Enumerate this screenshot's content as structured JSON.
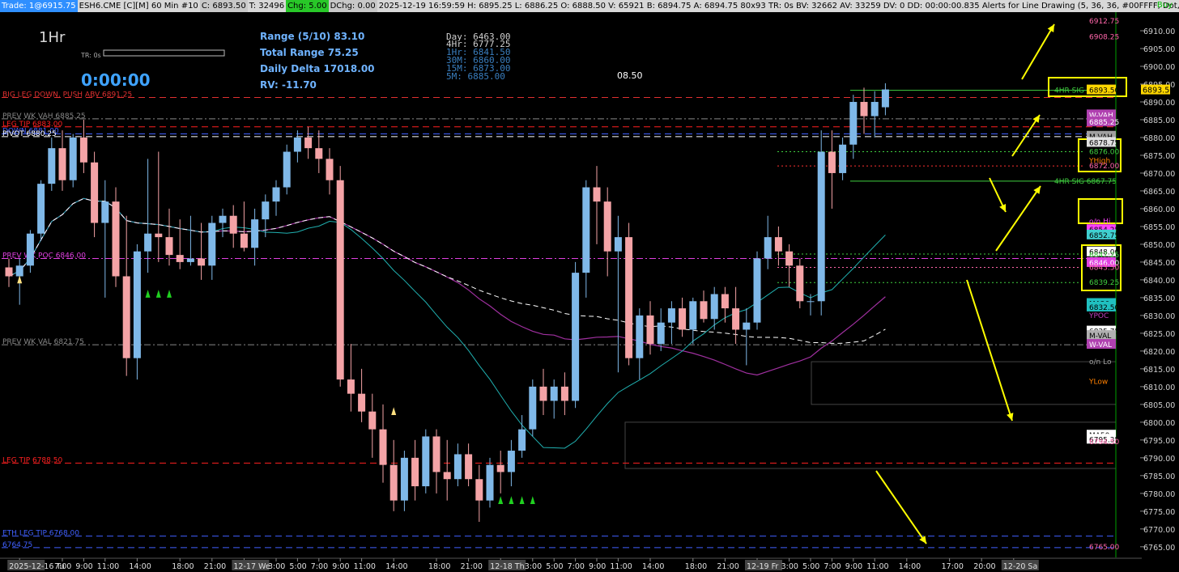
{
  "topbar": {
    "trade": "Trade: 1@6915.75",
    "symbol": "ESH6.CME [C][M]  60 Min  #10",
    "c": "C: 6893.50",
    "t": "T: 32496",
    "chg": "Chg: 5.00",
    "dchg": "DChg: 0.00",
    "info": "2025-12-19 16:59:59 H: 6895.25 L: 6886.25 O: 6888.50 V: 65921 B: 6894.75 A: 6894.75 80x93 TR: 0s BV: 32662 AV: 33259 DV: 0 DD: 00:00:00.835 Alerts for Line Drawing   (5, 36, 36, #00FFFF, Dot, 1, Yes, Right, Yes, 9, -2, No, Yes, 5",
    "buy": "Buy",
    "colors": {
      "trade_bg": "#2f8fff",
      "chg_bg": "#28c828",
      "gray_bg": "#c8c8c8"
    }
  },
  "overlay": {
    "timeframe": "1Hr",
    "tr_label": "TR: 0s",
    "timer": "0:00:00",
    "range": "Range (5/10) 83.10",
    "total_range": "Total Range 75.25",
    "daily_delta": "Daily Delta 17018.00",
    "rv": "RV: -11.70",
    "tf_values": [
      "Day:  6463.00",
      "4Hr:  6777.25",
      "1Hr:  6841.50",
      "30M:  6860.00",
      "15M:  6873.00",
      "5M:   6885.00"
    ],
    "mid_value": "08.50"
  },
  "chart_data": {
    "type": "candlestick",
    "symbol": "ESH6.CME",
    "interval": "60 Min",
    "ylim": [
      6762,
      6915
    ],
    "y_ticks": [
      6765,
      6770,
      6775,
      6780,
      6785,
      6790,
      6795,
      6800,
      6805,
      6810,
      6815,
      6820,
      6825,
      6830,
      6835,
      6840,
      6845,
      6850,
      6855,
      6860,
      6865,
      6870,
      6875,
      6880,
      6885,
      6890,
      6895,
      6900,
      6905,
      6910
    ],
    "x_labels": [
      {
        "bar": 1,
        "label": "2025-12-16 Tu",
        "boxed": true
      },
      {
        "bar": 5,
        "label": "7:00"
      },
      {
        "bar": 7,
        "label": "9:00"
      },
      {
        "bar": 9,
        "label": "11:00"
      },
      {
        "bar": 12,
        "label": "14:00"
      },
      {
        "bar": 16,
        "label": "18:00"
      },
      {
        "bar": 19,
        "label": "21:00"
      },
      {
        "bar": 22,
        "label": "12-17 We",
        "boxed": true
      },
      {
        "bar": 25,
        "label": "3:00"
      },
      {
        "bar": 27,
        "label": "5:00"
      },
      {
        "bar": 29,
        "label": "7:00"
      },
      {
        "bar": 31,
        "label": "9:00"
      },
      {
        "bar": 33,
        "label": "11:00"
      },
      {
        "bar": 36,
        "label": "14:00"
      },
      {
        "bar": 40,
        "label": "18:00"
      },
      {
        "bar": 43,
        "label": "21:00"
      },
      {
        "bar": 46,
        "label": "12-18 Th",
        "boxed": true
      },
      {
        "bar": 49,
        "label": "3:00"
      },
      {
        "bar": 51,
        "label": "5:00"
      },
      {
        "bar": 53,
        "label": "7:00"
      },
      {
        "bar": 55,
        "label": "9:00"
      },
      {
        "bar": 57,
        "label": "11:00"
      },
      {
        "bar": 60,
        "label": "14:00"
      },
      {
        "bar": 64,
        "label": "18:00"
      },
      {
        "bar": 67,
        "label": "21:00"
      },
      {
        "bar": 70,
        "label": "12-19 Fr",
        "boxed": true
      },
      {
        "bar": 73,
        "label": "3:00"
      },
      {
        "bar": 75,
        "label": "5:00"
      },
      {
        "bar": 77,
        "label": "7:00"
      },
      {
        "bar": 79,
        "label": "9:00"
      },
      {
        "bar": 81,
        "label": "11:00"
      },
      {
        "bar": 84,
        "label": "14:00"
      },
      {
        "bar": 88,
        "label": "17:00"
      },
      {
        "bar": 91,
        "label": "20:00"
      },
      {
        "bar": 94,
        "label": "12-20 Sa",
        "boxed": true
      }
    ],
    "candles": [
      [
        6843.5,
        6846,
        6838,
        6841
      ],
      [
        6841,
        6846,
        6833,
        6844
      ],
      [
        6844,
        6854,
        6842,
        6853
      ],
      [
        6853,
        6868,
        6851,
        6867
      ],
      [
        6867,
        6880,
        6865,
        6877
      ],
      [
        6877,
        6882,
        6865,
        6868
      ],
      [
        6868,
        6881,
        6866,
        6880
      ],
      [
        6880,
        6885,
        6870,
        6873
      ],
      [
        6873,
        6876,
        6852,
        6856
      ],
      [
        6856,
        6868,
        6835,
        6862
      ],
      [
        6862,
        6866,
        6838,
        6841
      ],
      [
        6841,
        6858,
        6813,
        6818
      ],
      [
        6818,
        6850,
        6812,
        6848
      ],
      [
        6848,
        6874,
        6842,
        6853
      ],
      [
        6853,
        6876,
        6845,
        6852
      ],
      [
        6852,
        6860,
        6844,
        6847
      ],
      [
        6847,
        6857,
        6843,
        6845
      ],
      [
        6845,
        6858,
        6844,
        6846
      ],
      [
        6846,
        6856,
        6840,
        6844
      ],
      [
        6844,
        6858,
        6840,
        6856
      ],
      [
        6856,
        6860,
        6852,
        6858
      ],
      [
        6858,
        6861,
        6849,
        6853
      ],
      [
        6853,
        6862,
        6848,
        6849
      ],
      [
        6849,
        6860,
        6844,
        6857
      ],
      [
        6857,
        6864,
        6852,
        6862
      ],
      [
        6862,
        6868,
        6858,
        6866
      ],
      [
        6866,
        6878,
        6864,
        6876
      ],
      [
        6876,
        6882,
        6873,
        6880
      ],
      [
        6880,
        6883,
        6874,
        6877
      ],
      [
        6877,
        6882,
        6870,
        6874
      ],
      [
        6874,
        6877,
        6864,
        6868
      ],
      [
        6868,
        6872,
        6810,
        6812
      ],
      [
        6812,
        6822,
        6803,
        6808
      ],
      [
        6808,
        6815,
        6800,
        6803
      ],
      [
        6803,
        6808,
        6790,
        6798
      ],
      [
        6798,
        6805,
        6783,
        6788
      ],
      [
        6788,
        6795,
        6775,
        6778
      ],
      [
        6778,
        6792,
        6775,
        6790
      ],
      [
        6790,
        6795,
        6778,
        6782
      ],
      [
        6782,
        6798,
        6780,
        6796
      ],
      [
        6796,
        6798,
        6780,
        6786
      ],
      [
        6786,
        6795,
        6778,
        6784
      ],
      [
        6784,
        6794,
        6782,
        6791
      ],
      [
        6791,
        6794,
        6782,
        6784
      ],
      [
        6784,
        6788,
        6772,
        6778
      ],
      [
        6778,
        6790,
        6776,
        6788
      ],
      [
        6788,
        6792,
        6780,
        6786
      ],
      [
        6786,
        6795,
        6782,
        6792
      ],
      [
        6792,
        6802,
        6790,
        6798
      ],
      [
        6798,
        6812,
        6796,
        6810
      ],
      [
        6810,
        6815,
        6802,
        6806
      ],
      [
        6806,
        6812,
        6801,
        6810
      ],
      [
        6810,
        6814,
        6802,
        6806
      ],
      [
        6806,
        6845,
        6804,
        6842
      ],
      [
        6842,
        6868,
        6835,
        6866
      ],
      [
        6866,
        6872,
        6850,
        6862
      ],
      [
        6862,
        6866,
        6841,
        6848
      ],
      [
        6848,
        6858,
        6814,
        6852
      ],
      [
        6852,
        6856,
        6816,
        6818
      ],
      [
        6818,
        6832,
        6812,
        6830
      ],
      [
        6830,
        6834,
        6819,
        6822
      ],
      [
        6822,
        6832,
        6820,
        6828
      ],
      [
        6828,
        6834,
        6822,
        6832
      ],
      [
        6832,
        6835,
        6824,
        6826
      ],
      [
        6826,
        6835,
        6822,
        6834
      ],
      [
        6834,
        6837,
        6828,
        6829
      ],
      [
        6829,
        6838,
        6826,
        6836
      ],
      [
        6836,
        6838,
        6828,
        6832
      ],
      [
        6832,
        6838,
        6822,
        6826
      ],
      [
        6826,
        6832,
        6816,
        6828
      ],
      [
        6828,
        6848,
        6826,
        6846
      ],
      [
        6846,
        6858,
        6843,
        6852
      ],
      [
        6852,
        6855,
        6844,
        6848
      ],
      [
        6848,
        6850,
        6838,
        6844
      ],
      [
        6844,
        6846,
        6832,
        6834
      ],
      [
        6834,
        6836,
        6830,
        6834
      ],
      [
        6834,
        6882,
        6830,
        6876
      ],
      [
        6876,
        6882,
        6860,
        6870
      ],
      [
        6870,
        6880,
        6868,
        6878
      ],
      [
        6878,
        6892,
        6874,
        6890
      ],
      [
        6890,
        6894,
        6881,
        6886
      ],
      [
        6886,
        6893,
        6880,
        6890
      ],
      [
        6888.5,
        6895.25,
        6886.25,
        6893.5
      ]
    ],
    "price_lines": [
      {
        "label": "BIG LEG DOWN, PUSH ABV  6891.25",
        "price": 6891.25,
        "color": "#e03030",
        "style": "dash"
      },
      {
        "label": "PREV WK VAH  6885.25",
        "price": 6885.25,
        "color": "#888888",
        "style": "dashdot"
      },
      {
        "label": "LEG TIP  6883.00",
        "price": 6883.0,
        "color": "#ff2020",
        "style": "dash"
      },
      {
        "label": "DOWN  6881.00",
        "price": 6881.0,
        "color": "#4060ff",
        "style": "dash"
      },
      {
        "label": "PIVOT  6880.25",
        "price": 6880.25,
        "color": "#ffffff",
        "style": "dash"
      },
      {
        "label": "PREV WK POC  6846.00",
        "price": 6846.0,
        "color": "#e040e0",
        "style": "dashdot"
      },
      {
        "label": "PREV WK VAL  6821.75",
        "price": 6821.75,
        "color": "#888888",
        "style": "dashdot"
      },
      {
        "label": "LEG TIP  6788.50",
        "price": 6788.5,
        "color": "#ff2020",
        "style": "dash"
      },
      {
        "label": "ETH LEG TIP  6768.00",
        "price": 6768.0,
        "color": "#4060ff",
        "style": "dash"
      },
      {
        "label": "6764.75",
        "price": 6764.75,
        "color": "#4060ff",
        "style": "dash"
      }
    ],
    "right_lines": [
      {
        "label": "4HR SIG  6893.25",
        "price": 6893.25,
        "color": "#40d040"
      },
      {
        "label": "4HR SIG  6867.75",
        "price": 6867.75,
        "color": "#40d040"
      }
    ],
    "axis_labels": [
      {
        "text": "6912.75",
        "price": 6912.75,
        "color": "#ff66aa",
        "style": "text"
      },
      {
        "text": "6908.25",
        "price": 6908.25,
        "color": "#ff66aa",
        "style": "text"
      },
      {
        "text": "6893.50",
        "price": 6893.5,
        "color": "#ffd700",
        "style": "box",
        "fg": "#000000"
      },
      {
        "text": "W-VAH",
        "price": 6886.5,
        "color": "#b040b0",
        "style": "box",
        "fg": "#ffffff"
      },
      {
        "text": "6885.25",
        "price": 6884.5,
        "color": "#b040b0",
        "style": "box",
        "fg": "#ffffff"
      },
      {
        "text": "M-VAH",
        "price": 6880.5,
        "color": "#a0a0a0",
        "style": "box",
        "fg": "#000000"
      },
      {
        "text": "6878.75",
        "price": 6878.75,
        "color": "#e0e0e0",
        "style": "box",
        "fg": "#000000"
      },
      {
        "text": "6876.00",
        "price": 6876.0,
        "color": "#40d040",
        "style": "text"
      },
      {
        "text": "YHigh",
        "price": 6873.5,
        "color": "#ff8000",
        "style": "text"
      },
      {
        "text": "6872.00",
        "price": 6872.0,
        "color": "#ff66aa",
        "style": "text"
      },
      {
        "text": "o/n Hi",
        "price": 6856.5,
        "color": "#ff40ff",
        "style": "text"
      },
      {
        "text": "6854.25",
        "price": 6854.25,
        "color": "#ff40ff",
        "style": "box",
        "fg": "#000000"
      },
      {
        "text": "6852.75",
        "price": 6852.75,
        "color": "#40d0d0",
        "style": "box",
        "fg": "#000000"
      },
      {
        "text": "6848.00",
        "price": 6848.0,
        "color": "#ffffff",
        "style": "box",
        "fg": "#000000"
      },
      {
        "text": "6847.25",
        "price": 6847.0,
        "color": "#40d040",
        "style": "text"
      },
      {
        "text": "6846.00",
        "price": 6845.0,
        "color": "#e040e0",
        "style": "box",
        "fg": "#ffffff"
      },
      {
        "text": "6843.50",
        "price": 6843.5,
        "color": "#ff66aa",
        "style": "text"
      },
      {
        "text": "6839.25",
        "price": 6839.25,
        "color": "#40d040",
        "style": "text"
      },
      {
        "text": "MA20",
        "price": 6833.5,
        "color": "#20c0c0",
        "style": "box",
        "fg": "#000000"
      },
      {
        "text": "6832.50",
        "price": 6832.5,
        "color": "#20c0c0",
        "style": "box",
        "fg": "#000000"
      },
      {
        "text": "YPOC",
        "price": 6830.0,
        "color": "#c040c0",
        "style": "text"
      },
      {
        "text": "6825.75",
        "price": 6825.75,
        "color": "#ffffff",
        "style": "box",
        "fg": "#000000"
      },
      {
        "text": "M-VAL",
        "price": 6824.5,
        "color": "#b0b0b0",
        "style": "box",
        "fg": "#000000"
      },
      {
        "text": "W-VAL",
        "price": 6822.0,
        "color": "#b040b0",
        "style": "box",
        "fg": "#ffffff"
      },
      {
        "text": "o/n Lo",
        "price": 6817.0,
        "color": "#a0a0a0",
        "style": "text"
      },
      {
        "text": "YLow",
        "price": 6811.5,
        "color": "#ff8000",
        "style": "text"
      },
      {
        "text": "MA50",
        "price": 6796.5,
        "color": "#ffffff",
        "style": "box",
        "fg": "#000000"
      },
      {
        "text": "6795.35",
        "price": 6795.35,
        "color": "#ffffff",
        "style": "box",
        "fg": "#000000"
      },
      {
        "text": "6794.50",
        "price": 6794.5,
        "color": "#ff66aa",
        "style": "text"
      },
      {
        "text": "6765.00",
        "price": 6765.0,
        "color": "#ff66aa",
        "style": "text"
      }
    ],
    "right_dotted_lines": [
      {
        "price": 6876.0,
        "color": "#40d040"
      },
      {
        "price": 6872.0,
        "color": "#ff3030"
      },
      {
        "price": 6847.25,
        "color": "#40d040"
      },
      {
        "price": 6843.5,
        "color": "#ff66aa"
      },
      {
        "price": 6839.25,
        "color": "#40d040"
      }
    ],
    "colors": {
      "up": "#7fb8e8",
      "down": "#f4a3a6",
      "background": "#000000",
      "vwap": "#a030a0",
      "ma20": "#20b0b0",
      "ma50": "#ffffff",
      "annotation": "#ffff00"
    }
  }
}
